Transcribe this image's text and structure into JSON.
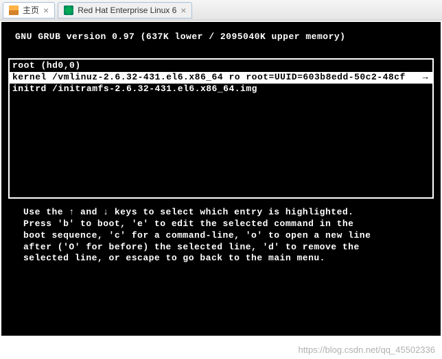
{
  "tabs": [
    {
      "label": "主页",
      "active": true
    },
    {
      "label": "Red Hat Enterprise Linux 6",
      "active": false
    }
  ],
  "grub": {
    "header": "GNU GRUB  version 0.97  (637K lower / 2095040K upper memory)",
    "lines": {
      "root": "root (hd0,0)",
      "kernel": "kernel /vmlinuz-2.6.32-431.el6.x86_64 ro root=UUID=603b8edd-50c2-48cf",
      "kernel_more": "→",
      "initrd": "initrd /initramfs-2.6.32-431.el6.x86_64.img"
    },
    "help": "Use the ↑ and ↓ keys to select which entry is highlighted.\nPress 'b' to boot, 'e' to edit the selected command in the\nboot sequence, 'c' for a command-line, 'o' to open a new line\nafter ('O' for before) the selected line, 'd' to remove the\nselected line, or escape to go back to the main menu."
  },
  "watermark": "https://blog.csdn.net/qq_45502336"
}
